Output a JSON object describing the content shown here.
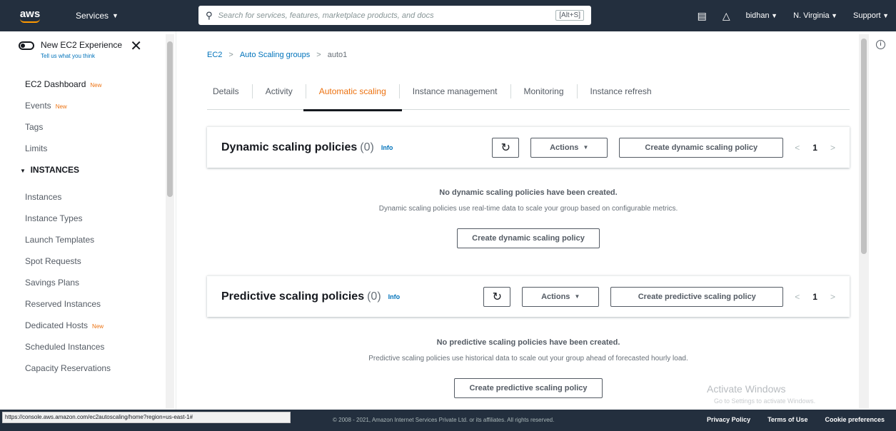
{
  "topnav": {
    "logo": "aws",
    "services": "Services",
    "search_placeholder": "Search for services, features, marketplace products, and docs",
    "search_shortcut": "[Alt+S]",
    "user": "bidhan",
    "region": "N. Virginia",
    "support": "Support"
  },
  "sidebar": {
    "toggle_label": "New EC2 Experience",
    "toggle_sub": "Tell us what you think",
    "new_badge": "New",
    "items_top": [
      {
        "label": "EC2 Dashboard",
        "badge": "New"
      },
      {
        "label": "Events",
        "badge": "New"
      },
      {
        "label": "Tags"
      },
      {
        "label": "Limits"
      }
    ],
    "section_instances": "INSTANCES",
    "instances": [
      "Instances",
      "Instance Types",
      "Launch Templates",
      "Spot Requests",
      "Savings Plans",
      "Reserved Instances",
      "Dedicated Hosts",
      "Scheduled Instances",
      "Capacity Reservations"
    ]
  },
  "breadcrumb": [
    "EC2",
    "Auto Scaling groups",
    "auto1"
  ],
  "tabs": [
    "Details",
    "Activity",
    "Automatic scaling",
    "Instance management",
    "Monitoring",
    "Instance refresh"
  ],
  "active_tab": "Automatic scaling",
  "dynamic": {
    "title": "Dynamic scaling policies",
    "count": "(0)",
    "info": "Info",
    "actions": "Actions",
    "create": "Create dynamic scaling policy",
    "page": "1",
    "empty_title": "No dynamic scaling policies have been created.",
    "empty_desc": "Dynamic scaling policies use real-time data to scale your group based on configurable metrics.",
    "empty_button": "Create dynamic scaling policy"
  },
  "predictive": {
    "title": "Predictive scaling policies",
    "count": "(0)",
    "info": "Info",
    "actions": "Actions",
    "create": "Create predictive scaling policy",
    "page": "1",
    "empty_title": "No predictive scaling policies have been created.",
    "empty_desc": "Predictive scaling policies use historical data to scale out your group ahead of forecasted hourly load.",
    "empty_button": "Create predictive scaling policy"
  },
  "watermark": {
    "title": "Activate Windows",
    "sub": "Go to Settings to activate Windows."
  },
  "footer": {
    "status_url": "https://console.aws.amazon.com/ec2autoscaling/home?region=us-east-1#",
    "copyright": "© 2008 - 2021, Amazon Internet Services Private Ltd. or its affiliates. All rights reserved.",
    "links": [
      "Privacy Policy",
      "Terms of Use",
      "Cookie preferences"
    ]
  },
  "colors": {
    "nav_bg": "#232f3e",
    "accent": "#ec7211",
    "link": "#0073bb"
  }
}
